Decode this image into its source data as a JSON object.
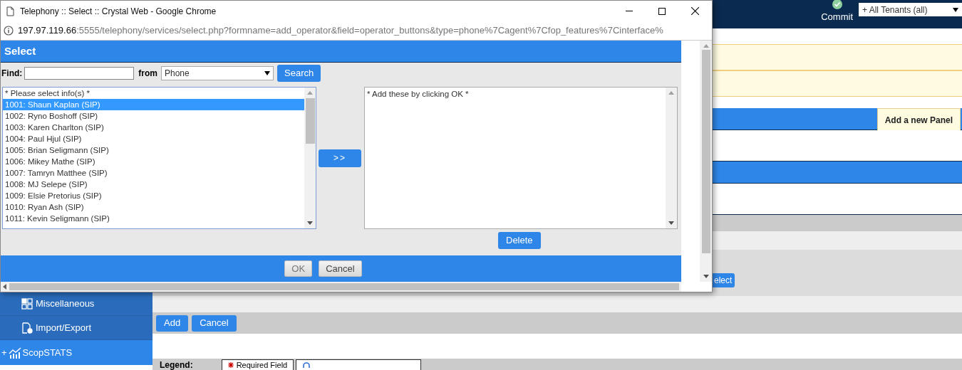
{
  "app": {
    "commit": "Commit",
    "tenant_select": "+ All Tenants (all)",
    "add_panel_button": "Add a new Panel",
    "select_button": "elect",
    "sidebar": [
      {
        "label": "Miscellaneous",
        "kind": "sub"
      },
      {
        "label": "Import/Export",
        "kind": "sub"
      },
      {
        "label": "ScopSTATS",
        "kind": "group",
        "expander": "+"
      }
    ],
    "form_buttons": [
      "Add",
      "Cancel"
    ],
    "legend": {
      "label": "Legend:",
      "items": [
        "Required Field"
      ]
    }
  },
  "browser_window": {
    "title": "Telephony :: Select :: Crystal Web - Google Chrome",
    "url_host": "197.97.119.66",
    "url_rest": ":5555/telephony/services/select.php?formname=add_operator&field=operator_buttons&type=phone%7Cagent%7Cfop_features%7Cinterface%"
  },
  "dialog": {
    "title": "Select",
    "find_label": "Find:",
    "from_label": "from",
    "source_select": "Phone",
    "search_button": "Search",
    "available_list": {
      "header": "* Please select info(s) *",
      "items": [
        {
          "label": "1001: Shaun Kaplan (SIP)",
          "selected": true
        },
        {
          "label": "1002: Ryno Boshoff (SIP)",
          "selected": false
        },
        {
          "label": "1003: Karen Charlton (SIP)",
          "selected": false
        },
        {
          "label": "1004: Paul Hjul (SIP)",
          "selected": false
        },
        {
          "label": "1005: Brian Seligmann (SIP)",
          "selected": false
        },
        {
          "label": "1006: Mikey Mathe (SIP)",
          "selected": false
        },
        {
          "label": "1007: Tamryn Matthee (SIP)",
          "selected": false
        },
        {
          "label": "1008: MJ Selepe (SIP)",
          "selected": false
        },
        {
          "label": "1009: Elsie Pretorius (SIP)",
          "selected": false
        },
        {
          "label": "1010: Ryan Ash (SIP)",
          "selected": false
        },
        {
          "label": "1011: Kevin Seligmann (SIP)",
          "selected": false
        }
      ]
    },
    "move_button": ">>",
    "selected_list": {
      "header": "* Add these by clicking OK *"
    },
    "delete_button": "Delete",
    "ok_button": "OK",
    "cancel_button": "Cancel"
  }
}
